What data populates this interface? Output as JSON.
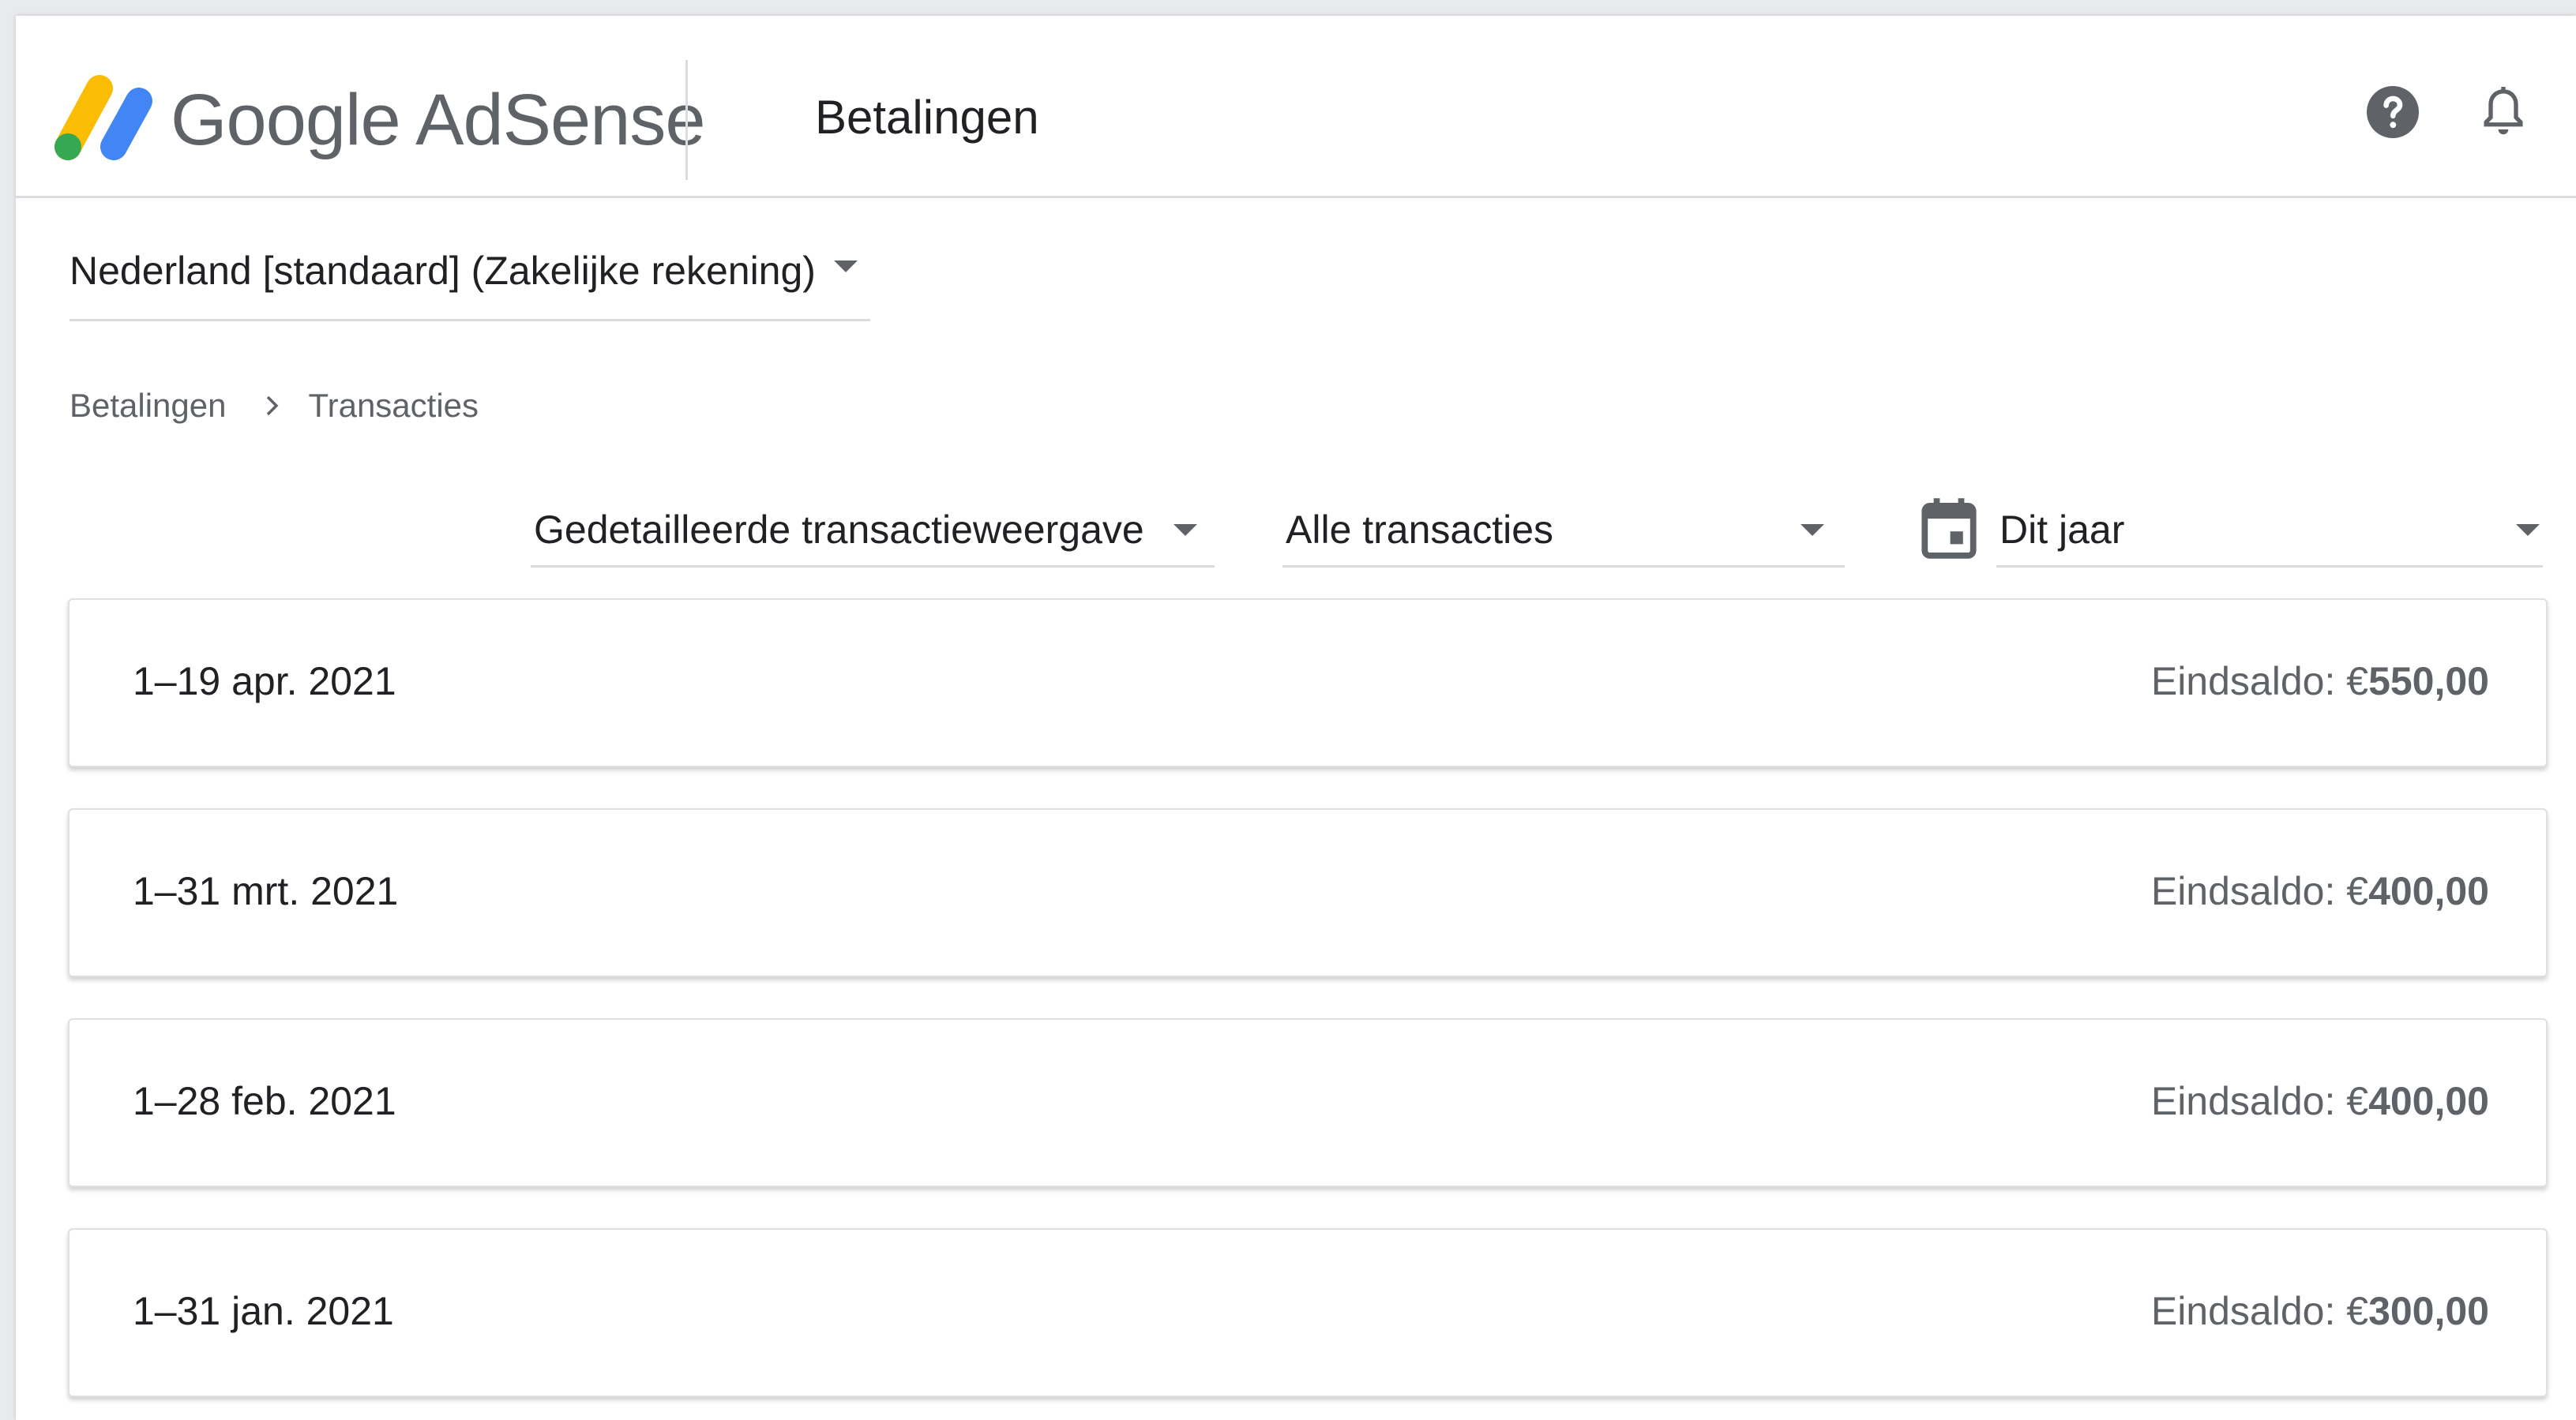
{
  "header": {
    "brand": "Google AdSense",
    "title": "Betalingen",
    "help_icon": "help-circle-icon",
    "notifications_icon": "bell-icon"
  },
  "account_selector": {
    "value": "Nederland [standaard] (Zakelijke rekening)"
  },
  "breadcrumb": {
    "items": [
      "Betalingen",
      "Transacties"
    ]
  },
  "filters": {
    "view": "Gedetailleerde transactieweergave",
    "transactions": "Alle transacties",
    "date_range": "Dit jaar"
  },
  "periods": [
    {
      "range": "1–19 apr. 2021",
      "label": "Eindsaldo:",
      "currency": "€",
      "amount": "550,00"
    },
    {
      "range": "1–31 mrt. 2021",
      "label": "Eindsaldo:",
      "currency": "€",
      "amount": "400,00"
    },
    {
      "range": "1–28 feb. 2021",
      "label": "Eindsaldo:",
      "currency": "€",
      "amount": "400,00"
    },
    {
      "range": "1–31 jan. 2021",
      "label": "Eindsaldo:",
      "currency": "€",
      "amount": "300,00"
    }
  ],
  "colors": {
    "logo_yellow": "#fbbc04",
    "logo_blue": "#4285f4",
    "logo_green": "#34a853",
    "text_secondary": "#5f6368",
    "divider": "#dadce0"
  }
}
